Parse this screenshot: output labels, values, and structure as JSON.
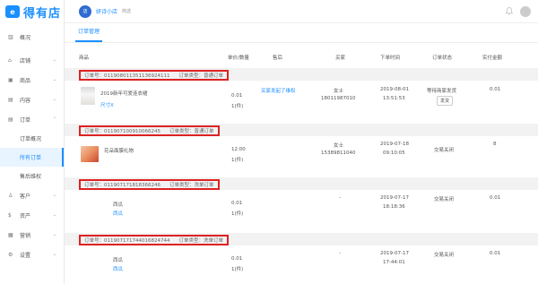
{
  "logo": {
    "badge": "e",
    "text": "得有店"
  },
  "sidebar": {
    "items": [
      {
        "icon": "▥",
        "label": "概况",
        "chevron": ""
      },
      {
        "icon": "⌂",
        "label": "店铺",
        "chevron": "⌄"
      },
      {
        "icon": "▣",
        "label": "商品",
        "chevron": "⌄"
      },
      {
        "icon": "▤",
        "label": "内容",
        "chevron": "⌄"
      },
      {
        "icon": "▤",
        "label": "订单",
        "chevron": "⌃"
      }
    ],
    "sub_items": [
      {
        "label": "订单概况"
      },
      {
        "label": "所有订单"
      },
      {
        "label": "售后维权"
      }
    ],
    "items_bottom": [
      {
        "icon": "♙",
        "label": "客户",
        "chevron": "⌄"
      },
      {
        "icon": "$",
        "label": "资产",
        "chevron": "⌄"
      },
      {
        "icon": "▦",
        "label": "营销",
        "chevron": "⌄"
      },
      {
        "icon": "⚙",
        "label": "设置",
        "chevron": "⌄"
      }
    ]
  },
  "header": {
    "store_name": "妍诗小店",
    "store_tag": "简选",
    "avatar_glyph": "店"
  },
  "tabs": [
    {
      "label": "订单管理"
    }
  ],
  "table": {
    "columns": [
      "商品",
      "单价/数量",
      "售后",
      "买家",
      "下单时间",
      "订单状态",
      "实付金额"
    ]
  },
  "orders": [
    {
      "order_no_label": "订单号：011908011351136924111",
      "order_type": "订单类型：普通订单",
      "product_name": "2019新年可爱连衣裙",
      "product_spec": "尺寸X",
      "price": "0.01",
      "qty": "1(件)",
      "after_sale": "买家发起了维权",
      "buyer_name": "女士",
      "buyer_phone": "18011987010",
      "date": "2019-08-01",
      "time": "13:51:53",
      "status": "等待商家发货",
      "action": "发货",
      "paid": "0.01"
    },
    {
      "order_no_label": "订单号：011907100910066245",
      "order_type": "订单类型：普通订单",
      "product_name": "花朵面膜礼物",
      "product_spec": "",
      "price": "12.00",
      "qty": "1(件)",
      "after_sale": "",
      "buyer_name": "女士",
      "buyer_phone": "15389811040",
      "date": "2019-07-18",
      "time": "09:10:05",
      "status": "交易关闭",
      "action": "",
      "paid": "8"
    },
    {
      "order_no_label": "订单号：011907171818366246",
      "order_type": "订单类型：洗单订单",
      "product_name": "西瓜",
      "product_spec": "西瓜",
      "price": "0.01",
      "qty": "1(件)",
      "after_sale": "",
      "buyer_name": "-",
      "buyer_phone": "",
      "date": "2019-07-17",
      "time": "18:18:36",
      "status": "交易关闭",
      "action": "",
      "paid": "0.01"
    },
    {
      "order_no_label": "订单号：011907171744016824744",
      "order_type": "订单类型：洗单订单",
      "product_name": "西瓜",
      "product_spec": "西瓜",
      "price": "0.01",
      "qty": "1(件)",
      "after_sale": "",
      "buyer_name": "-",
      "buyer_phone": "",
      "date": "2019-07-17",
      "time": "17:44:01",
      "status": "交易关闭",
      "action": "",
      "paid": "0.01"
    }
  ]
}
